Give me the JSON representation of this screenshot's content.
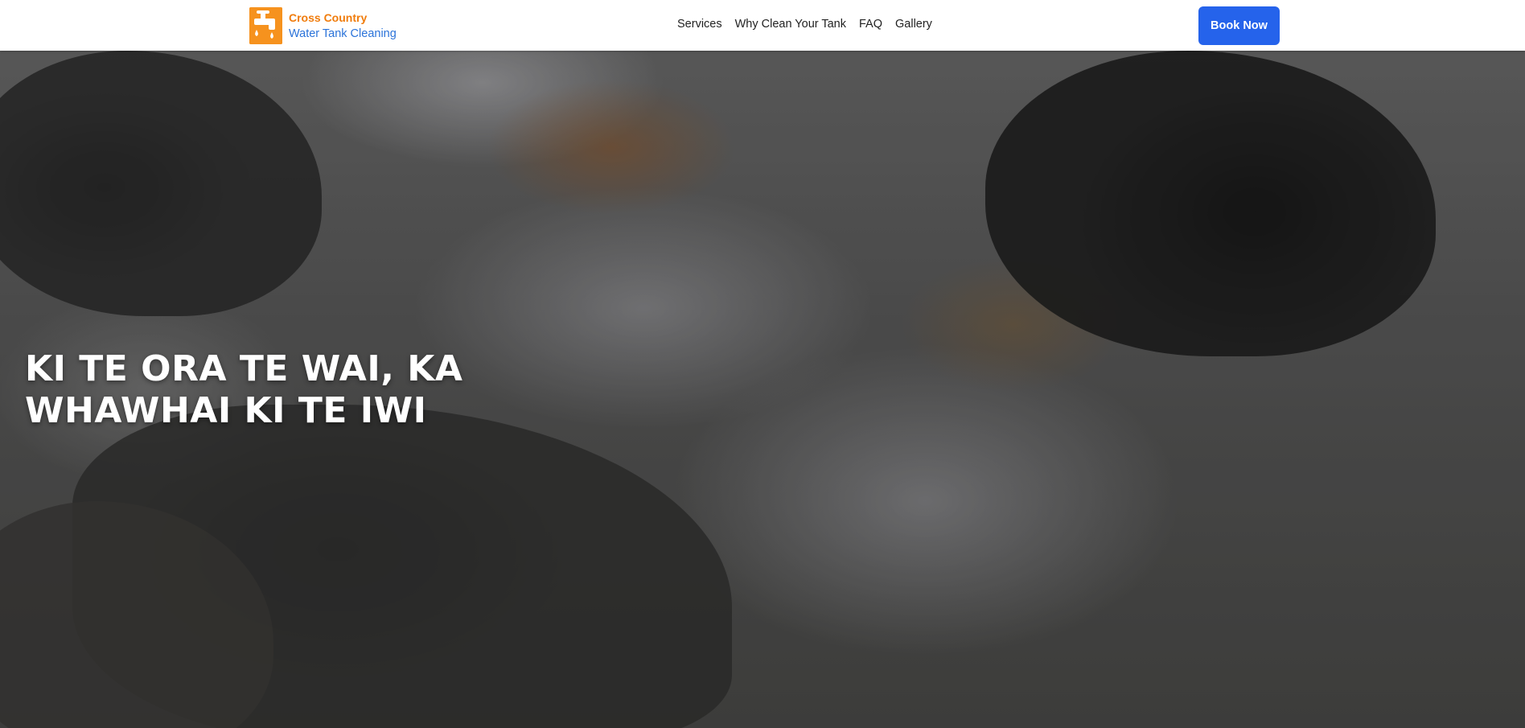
{
  "header": {
    "logo": {
      "line1": "Cross Country",
      "line2": "Water Tank Cleaning",
      "icon": "water-tap-icon"
    },
    "nav": [
      {
        "label": "Services"
      },
      {
        "label": "Why Clean Your Tank"
      },
      {
        "label": "FAQ"
      },
      {
        "label": "Gallery"
      }
    ],
    "cta_label": "Book Now"
  },
  "hero": {
    "title": "KI TE ORA TE WAI, KA WHAWHAI KI TE IWI"
  },
  "colors": {
    "brand_orange": "#f6921e",
    "brand_blue": "#2b73d9",
    "cta_blue": "#2563eb"
  }
}
